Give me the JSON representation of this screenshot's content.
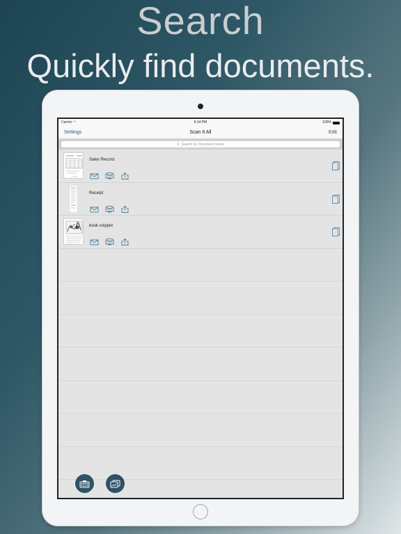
{
  "promo": {
    "title": "Search",
    "subtitle": "Quickly find documents."
  },
  "status_bar": {
    "carrier": "Carrier",
    "time": "6:14 PM",
    "battery": "100%"
  },
  "nav": {
    "left_label": "Settings",
    "title": "Scan It All",
    "right_label": "Edit"
  },
  "search": {
    "placeholder": "Search by Document Name"
  },
  "documents": [
    {
      "name": "Sales Record",
      "thumbnail": "table-document"
    },
    {
      "name": "Receipt",
      "thumbnail": "receipt-document"
    },
    {
      "name": "book snippet",
      "thumbnail": "illustrated-page"
    }
  ],
  "row_actions": [
    "mail-icon",
    "fax-icon",
    "share-icon"
  ],
  "bottom_buttons": [
    "camera-scan-icon",
    "photo-import-icon"
  ],
  "colors": {
    "accent": "#2e5366",
    "link": "#2b5b7a",
    "icon": "#4b7896"
  }
}
